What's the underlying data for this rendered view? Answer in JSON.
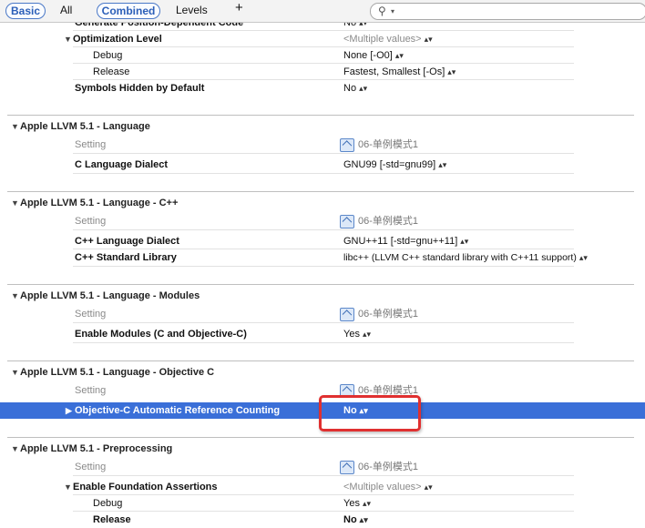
{
  "toolbar": {
    "basic": "Basic",
    "all": "All",
    "combined": "Combined",
    "levels": "Levels",
    "add": "+"
  },
  "rows_top": [
    {
      "label": "Generate Position-Dependent Code",
      "value": "No"
    },
    {
      "label": "Optimization Level",
      "value": "<Multiple values>"
    },
    {
      "label": "Debug",
      "value": "None [-O0]"
    },
    {
      "label": "Release",
      "value": "Fastest, Smallest [-Os]"
    },
    {
      "label": "Symbols Hidden by Default",
      "value": "No"
    }
  ],
  "sections": [
    {
      "title": "Apple LLVM 5.1 - Language",
      "setting": "Setting",
      "target": "06-单例模式1",
      "rows": [
        {
          "label": "C Language Dialect",
          "value": "GNU99 [-std=gnu99]"
        }
      ]
    },
    {
      "title": "Apple LLVM 5.1 - Language - C++",
      "setting": "Setting",
      "target": "06-单例模式1",
      "rows": [
        {
          "label": "C++ Language Dialect",
          "value": "GNU++11 [-std=gnu++11]"
        },
        {
          "label": "C++ Standard Library",
          "value": "libc++ (LLVM C++ standard library with C++11 support)"
        }
      ]
    },
    {
      "title": "Apple LLVM 5.1 - Language - Modules",
      "setting": "Setting",
      "target": "06-单例模式1",
      "rows": [
        {
          "label": "Enable Modules (C and Objective-C)",
          "value": "Yes"
        }
      ]
    },
    {
      "title": "Apple LLVM 5.1 - Language - Objective C",
      "setting": "Setting",
      "target": "06-单例模式1",
      "rows": [
        {
          "label": "Objective-C Automatic Reference Counting",
          "value": "No"
        }
      ]
    },
    {
      "title": "Apple LLVM 5.1 - Preprocessing",
      "setting": "Setting",
      "target": "06-单例模式1",
      "rows": [
        {
          "label": "Enable Foundation Assertions",
          "value": "<Multiple values>"
        },
        {
          "label": "Debug",
          "value": "Yes"
        },
        {
          "label": "Release",
          "value": "No"
        }
      ]
    }
  ],
  "colors": {
    "selection": "#3a6fd8",
    "highlight_box": "#e03030",
    "accent": "#2c5fb8"
  }
}
